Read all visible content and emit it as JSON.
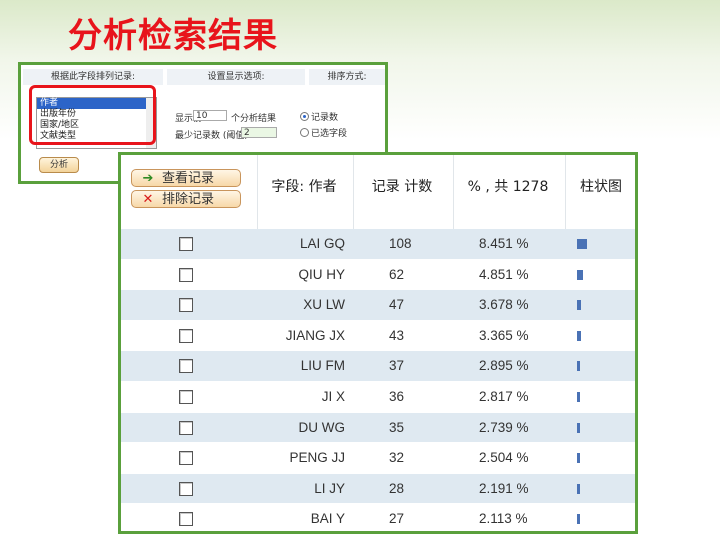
{
  "slide": {
    "title": "分析检索结果"
  },
  "options": {
    "header_field": "根据此字段排列记录:",
    "header_display": "设置显示选项:",
    "header_sort": "排序方式:",
    "field_list": [
      "作者",
      "出版年份",
      "国家/地区",
      "文献类型"
    ],
    "show_top_label": "显示前",
    "show_top_value": "10",
    "show_top_suffix": "个分析结果",
    "min_count_label": "最少记录数 (阈值):",
    "min_count_value": "2",
    "sort_by_count": "记录数",
    "sort_by_field": "已选字段",
    "analyze_button": "分析"
  },
  "results": {
    "view_button": "查看记录",
    "exclude_button": "排除记录",
    "columns": {
      "field": "字段: 作者",
      "count": "记录 计数",
      "percent": "% , 共 1278",
      "bar": "柱状图"
    },
    "rows": [
      {
        "name": "LAI GQ",
        "count": "108",
        "percent": "8.451 %",
        "fraction": 0.08451
      },
      {
        "name": "QIU HY",
        "count": "62",
        "percent": "4.851 %",
        "fraction": 0.04851
      },
      {
        "name": "XU LW",
        "count": "47",
        "percent": "3.678 %",
        "fraction": 0.03678
      },
      {
        "name": "JIANG JX",
        "count": "43",
        "percent": "3.365 %",
        "fraction": 0.03365
      },
      {
        "name": "LIU FM",
        "count": "37",
        "percent": "2.895 %",
        "fraction": 0.02895
      },
      {
        "name": "JI X",
        "count": "36",
        "percent": "2.817 %",
        "fraction": 0.02817
      },
      {
        "name": "DU WG",
        "count": "35",
        "percent": "2.739 %",
        "fraction": 0.02739
      },
      {
        "name": "PENG JJ",
        "count": "32",
        "percent": "2.504 %",
        "fraction": 0.02504
      },
      {
        "name": "LI JY",
        "count": "28",
        "percent": "2.191 %",
        "fraction": 0.02191
      },
      {
        "name": "BAI Y",
        "count": "27",
        "percent": "2.113 %",
        "fraction": 0.02113
      }
    ]
  },
  "colors": {
    "title": "#e8141b",
    "frame": "#5aa03c",
    "bar": "#4a72b5",
    "row_alt": "#dfe9f1"
  }
}
